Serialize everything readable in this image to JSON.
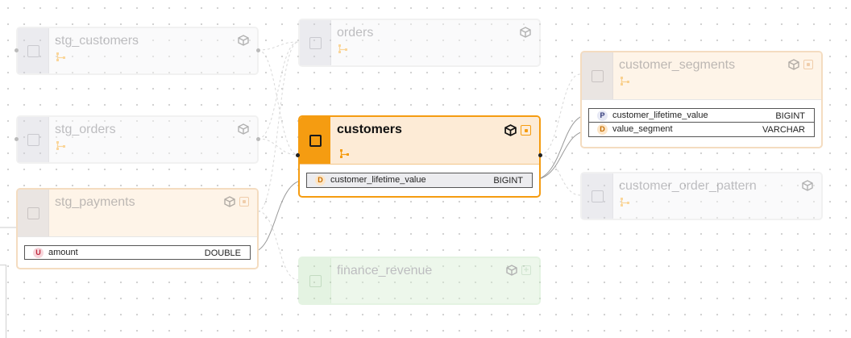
{
  "colors": {
    "accent": "#f59c11",
    "accent_bg": "#fdebd6",
    "default_chip": "#d4d4dc",
    "default_bg": "#f6f6f8",
    "finance_bg": "#d8efd5",
    "edge": "#888888"
  },
  "nodes": {
    "stg_customers": {
      "title": "stg_customers",
      "icons": [
        "cube-icon"
      ]
    },
    "stg_orders": {
      "title": "stg_orders",
      "icons": [
        "cube-icon"
      ]
    },
    "stg_payments": {
      "title": "stg_payments",
      "icons": [
        "cube-icon",
        "source-badge-icon"
      ],
      "columns": [
        {
          "key": "U",
          "name": "amount",
          "type": "DOUBLE"
        }
      ]
    },
    "orders": {
      "title": "orders",
      "icons": [
        "cube-icon"
      ]
    },
    "customers": {
      "title": "customers",
      "selected": true,
      "icons": [
        "cube-icon",
        "source-badge-icon"
      ],
      "columns": [
        {
          "key": "D",
          "name": "customer_lifetime_value",
          "type": "BIGINT"
        }
      ]
    },
    "finance_revenue": {
      "title": "finance_revenue",
      "icons": [
        "cube-icon",
        "add-badge-icon"
      ]
    },
    "customer_segments": {
      "title": "customer_segments",
      "icons": [
        "cube-icon",
        "source-badge-icon"
      ],
      "columns": [
        {
          "key": "P",
          "name": "customer_lifetime_value",
          "type": "BIGINT"
        },
        {
          "key": "D",
          "name": "value_segment",
          "type": "VARCHAR"
        }
      ]
    },
    "customer_order_pattern": {
      "title": "customer_order_pattern",
      "icons": [
        "cube-icon"
      ]
    }
  }
}
